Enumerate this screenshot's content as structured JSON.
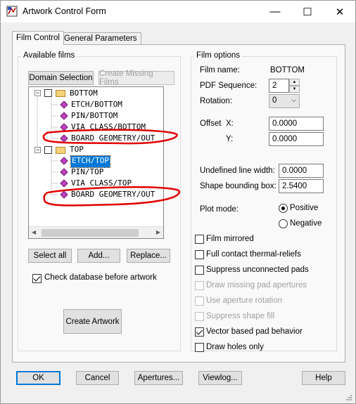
{
  "window": {
    "title": "Artwork Control Form",
    "minimize_glyph": "—",
    "maximize_glyph": "☐",
    "close_glyph": "✕"
  },
  "tabs": [
    {
      "label": "Film Control",
      "active": true
    },
    {
      "label": "General Parameters",
      "active": false
    }
  ],
  "available_films": {
    "legend": "Available films",
    "domain_selection_label": "Domain Selection",
    "create_missing_label": "Create Missing Films",
    "tree": [
      {
        "label": "BOTTOM",
        "type": "folder"
      },
      {
        "label": "ETCH/BOTTOM",
        "type": "item"
      },
      {
        "label": "PIN/BOTTOM",
        "type": "item"
      },
      {
        "label": "VIA CLASS/BOTTOM",
        "type": "item"
      },
      {
        "label": "BOARD GEOMETRY/OUT",
        "type": "item"
      },
      {
        "label": "TOP",
        "type": "folder"
      },
      {
        "label": "ETCH/TOP",
        "type": "item",
        "selected": true
      },
      {
        "label": "PIN/TOP",
        "type": "item"
      },
      {
        "label": "VIA CLASS/TOP",
        "type": "item"
      },
      {
        "label": "BOARD GEOMETRY/OUT",
        "type": "item"
      }
    ],
    "select_all_label": "Select all",
    "add_label": "Add...",
    "replace_label": "Replace...",
    "check_db_label": "Check database before artwork",
    "check_db_checked": true,
    "create_artwork_label": "Create Artwork"
  },
  "film_options": {
    "legend": "Film options",
    "film_name_label": "Film name:",
    "film_name_value": "BOTTOM",
    "pdf_sequence_label": "PDF Sequence:",
    "pdf_sequence_value": "2",
    "rotation_label": "Rotation:",
    "rotation_value": "0",
    "offset_label": "Offset",
    "offset_x_label": "X:",
    "offset_x_value": "0.0000",
    "offset_y_label": "Y:",
    "offset_y_value": "0.0000",
    "undefined_line_width_label": "Undefined line width:",
    "undefined_line_width_value": "0.0000",
    "shape_bounding_box_label": "Shape bounding box:",
    "shape_bounding_box_value": "2.5400",
    "plot_mode_label": "Plot mode:",
    "plot_mode_positive": "Positive",
    "plot_mode_negative": "Negative",
    "checkboxes": [
      {
        "label": "Film mirrored",
        "checked": false,
        "enabled": true
      },
      {
        "label": "Full contact thermal-reliefs",
        "checked": false,
        "enabled": true
      },
      {
        "label": "Suppress unconnected pads",
        "checked": false,
        "enabled": true
      },
      {
        "label": "Draw missing pad apertures",
        "checked": false,
        "enabled": false
      },
      {
        "label": "Use aperture rotation",
        "checked": false,
        "enabled": false
      },
      {
        "label": "Suppress shape fill",
        "checked": false,
        "enabled": false
      },
      {
        "label": "Vector based pad behavior",
        "checked": true,
        "enabled": true
      },
      {
        "label": "Draw holes only",
        "checked": false,
        "enabled": true
      }
    ]
  },
  "footer": {
    "ok_label": "OK",
    "cancel_label": "Cancel",
    "apertures_label": "Apertures...",
    "viewlog_label": "Viewlog...",
    "help_label": "Help"
  },
  "colors": {
    "annotation_red": "#e00000",
    "selection_blue": "#0078d7",
    "film_icon": "#c040c0"
  }
}
